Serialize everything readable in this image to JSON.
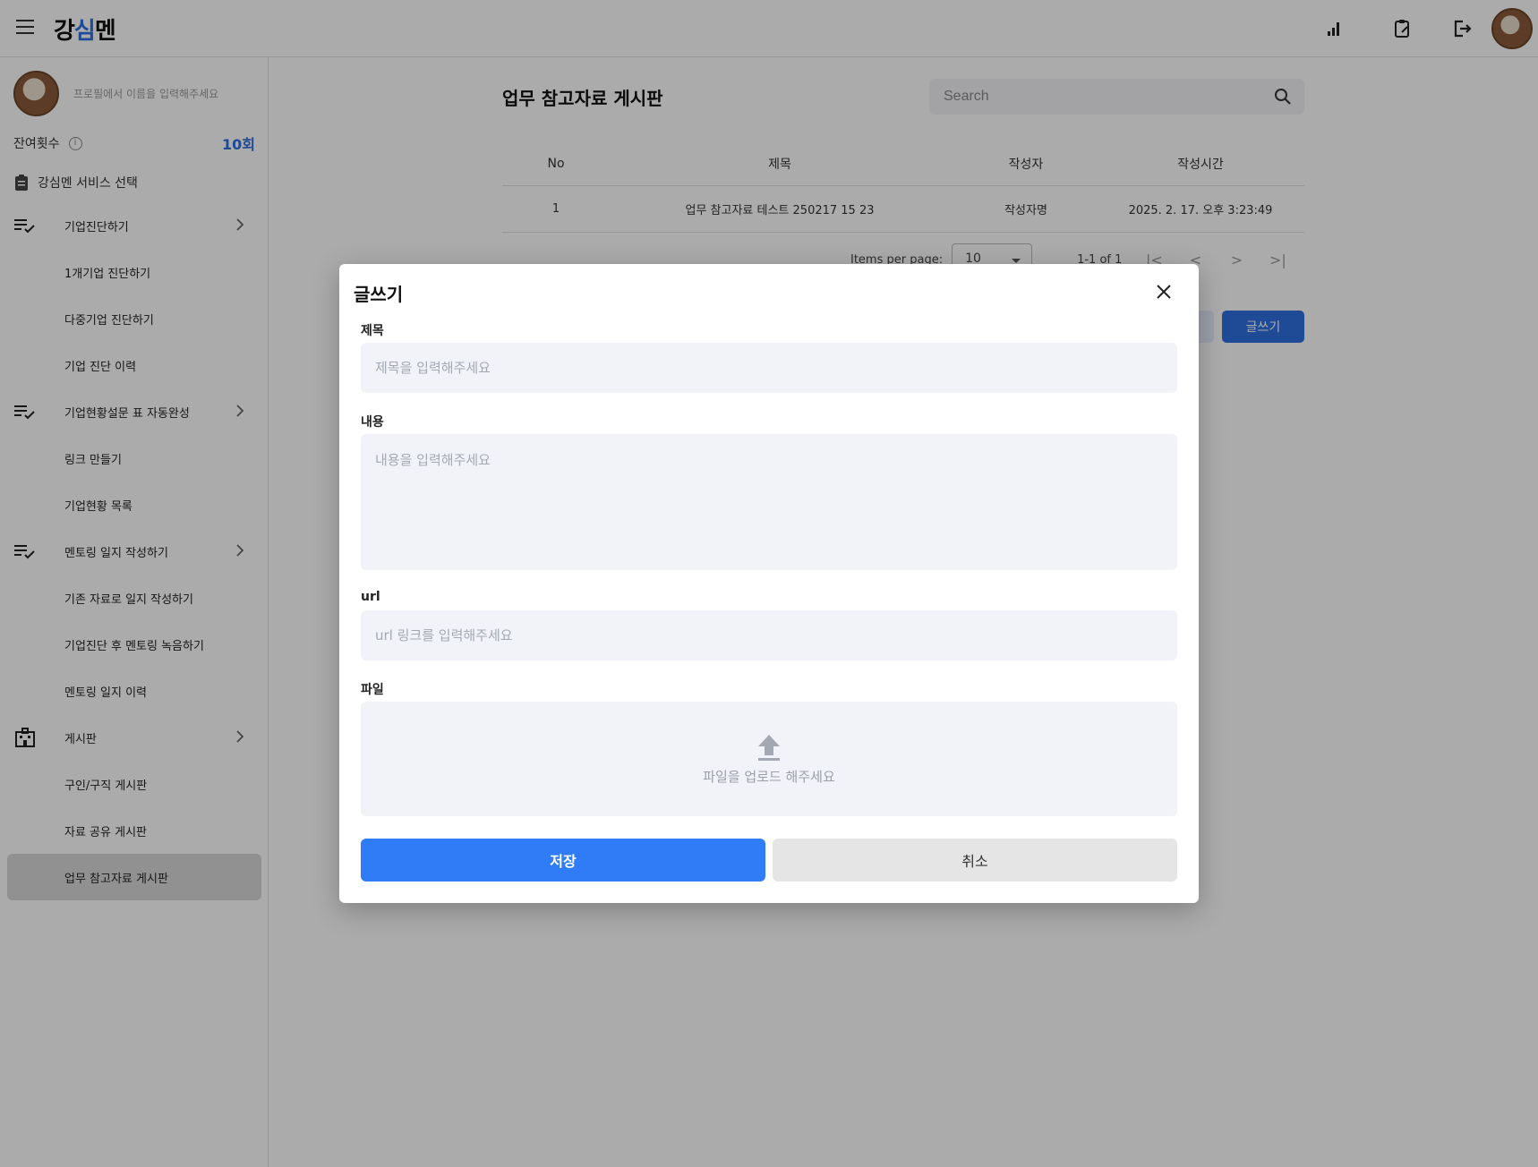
{
  "header": {
    "logo_main": "강",
    "logo_accent": "심",
    "logo_end": "멘"
  },
  "sidebar": {
    "profile_placeholder": "프로필에서 이름을 입력해주세요",
    "remaining_label": "잔여횟수",
    "remaining_count": "10회",
    "service_title": "강심멘 서비스 선택",
    "items": [
      {
        "label": "기업진단하기",
        "type": "group"
      },
      {
        "label": "1개기업 진단하기",
        "type": "sub"
      },
      {
        "label": "다중기업 진단하기",
        "type": "sub"
      },
      {
        "label": "기업 진단 이력",
        "type": "sub"
      },
      {
        "label": "기업현황설문 표 자동완성",
        "type": "group"
      },
      {
        "label": "링크 만들기",
        "type": "sub"
      },
      {
        "label": "기업현황 목록",
        "type": "sub"
      },
      {
        "label": "멘토링 일지 작성하기",
        "type": "group"
      },
      {
        "label": "기존 자료로 일지 작성하기",
        "type": "sub"
      },
      {
        "label": "기업진단 후 멘토링 녹음하기",
        "type": "sub"
      },
      {
        "label": "멘토링 일지 이력",
        "type": "sub"
      },
      {
        "label": "게시판",
        "type": "group"
      },
      {
        "label": "구인/구직 게시판",
        "type": "sub"
      },
      {
        "label": "자료 공유 게시판",
        "type": "sub"
      },
      {
        "label": "업무 참고자료 게시판",
        "type": "sub",
        "active": true
      }
    ]
  },
  "main": {
    "title": "업무 참고자료 게시판",
    "search_placeholder": "Search",
    "table": {
      "headers": [
        "No",
        "제목",
        "작성자",
        "작성시간"
      ],
      "rows": [
        [
          "1",
          "업무 참고자료 테스트 250217 15 23",
          "작성자명",
          "2025. 2. 17. 오후 3:23:49"
        ]
      ]
    },
    "pagination": {
      "items_per_page_label": "Items per page:",
      "items_per_page_value": "10",
      "range": "1-1 of 1"
    },
    "write_button": "글쓰기"
  },
  "dialog": {
    "title": "글쓰기",
    "title_label": "제목",
    "title_placeholder": "제목을 입력해주세요",
    "content_label": "내용",
    "content_placeholder": "내용을 입력해주세요",
    "url_label": "url",
    "url_placeholder": "url 링크를 입력해주세요",
    "file_label": "파일",
    "file_placeholder": "파일을 업로드 해주세요",
    "save_button": "저장",
    "cancel_button": "취소"
  },
  "colors": {
    "accent": "#2f6fe0",
    "save_button": "#2f7cf6",
    "input_bg": "#f1f3f8",
    "overlay": "rgba(0,0,0,0.33)"
  }
}
